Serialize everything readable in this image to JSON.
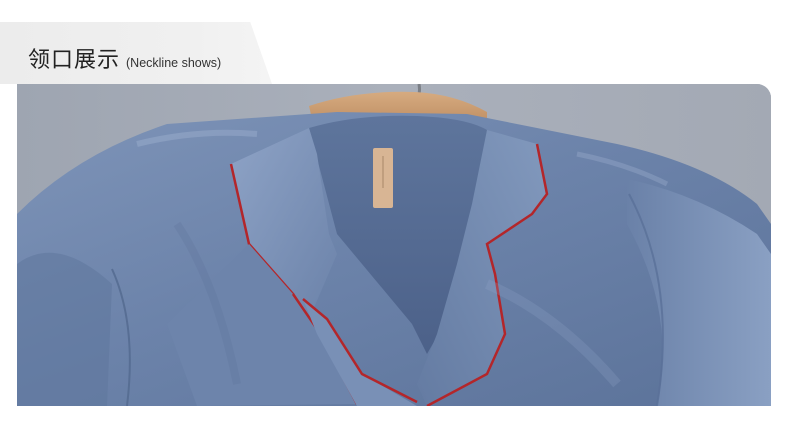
{
  "header": {
    "title_cn": "领口展示",
    "title_en": "(Neckline shows)"
  },
  "photo": {
    "subject": "blue satin pajama top with red piped collar on wooden hanger",
    "colors": {
      "background": "#a5abb6",
      "fabric": "#6f86ad",
      "fabric_light": "#8ea3c4",
      "fabric_dark": "#4f6790",
      "piping": "#b3262a",
      "hanger": "#c99a6d",
      "label": "#d8b594"
    }
  }
}
